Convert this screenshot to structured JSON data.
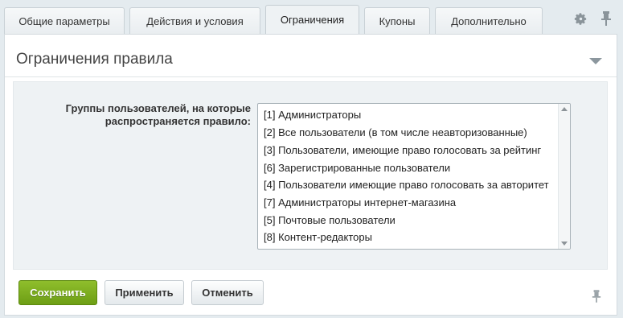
{
  "tabs": [
    {
      "label": "Общие параметры",
      "active": false
    },
    {
      "label": "Действия и условия",
      "active": false
    },
    {
      "label": "Ограничения",
      "active": true
    },
    {
      "label": "Купоны",
      "active": false
    },
    {
      "label": "Дополнительно",
      "active": false
    }
  ],
  "toolbar_icons": {
    "settings": "gear-icon",
    "pin": "pin-icon"
  },
  "section": {
    "title": "Ограничения правила",
    "collapse_icon": "chevron-down-icon"
  },
  "user_groups": {
    "label": "Группы пользователей, на которые распространяется правило:",
    "options": [
      "[1] Администраторы",
      "[2] Все пользователи (в том числе неавторизованные)",
      "[3] Пользователи, имеющие право голосовать за рейтинг",
      "[6] Зарегистрированные пользователи",
      "[4] Пользователи имеющие право голосовать за авторитет",
      "[7] Администраторы интернет-магазина",
      "[5] Почтовые пользователи",
      "[8] Контент-редакторы"
    ]
  },
  "buttons": {
    "save": "Сохранить",
    "apply": "Применить",
    "cancel": "Отменить"
  },
  "colors": {
    "primary_button": "#7aac1c",
    "background": "#e4ebef"
  }
}
